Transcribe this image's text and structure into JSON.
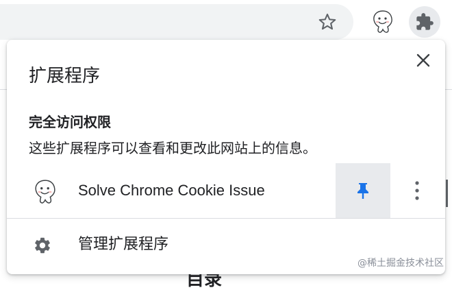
{
  "toolbar": {
    "icons": [
      "star-icon",
      "smiley-extension-icon",
      "puzzle-icon"
    ]
  },
  "background": {
    "bottom_text": "目录"
  },
  "popup": {
    "title": "扩展程序",
    "close_icon": "close-icon",
    "section_heading": "完全访问权限",
    "section_description": "这些扩展程序可以查看和更改此网站上的信息。",
    "extensions": [
      {
        "name": "Solve Chrome Cookie Issue",
        "icon": "smiley-extension-icon",
        "pinned": true,
        "pin_color": "#1a73e8"
      }
    ],
    "manage_label": "管理扩展程序",
    "manage_icon": "gear-icon"
  },
  "watermark": "@稀土掘金技术社区",
  "colors": {
    "accent": "#1a73e8",
    "icon_gray": "#5f6368",
    "hover_bg": "#e8eaed"
  }
}
